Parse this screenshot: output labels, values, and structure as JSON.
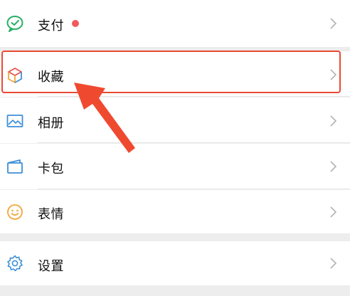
{
  "menu": {
    "items": [
      {
        "label": "支付",
        "icon": "wechat-pay-icon",
        "badge": "red-dot"
      },
      {
        "label": "收藏",
        "icon": "favorites-cube-icon",
        "highlighted": true
      },
      {
        "label": "相册",
        "icon": "photo-album-icon"
      },
      {
        "label": "卡包",
        "icon": "card-wallet-icon"
      },
      {
        "label": "表情",
        "icon": "emoji-smile-icon"
      },
      {
        "label": "设置",
        "icon": "settings-gear-icon"
      }
    ]
  },
  "colors": {
    "pay_green": "#2aae67",
    "badge_red": "#f25b5b",
    "annotation_red": "#e84a32",
    "icon_blue": "#3d8fd6",
    "emoji_orange": "#f2a53a",
    "background": "#ededed"
  }
}
